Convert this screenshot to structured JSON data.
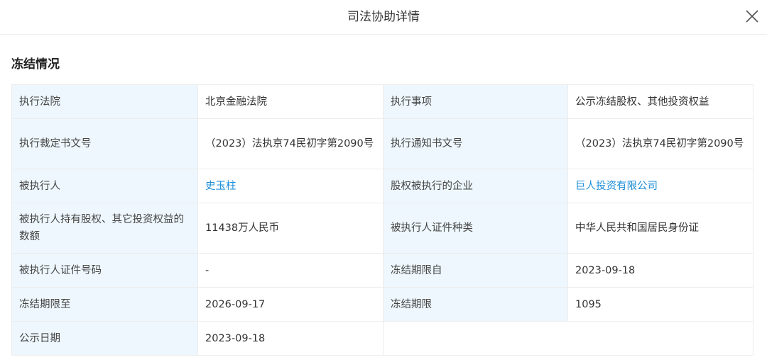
{
  "dialog": {
    "title": "司法协助详情",
    "close_icon": "close-icon"
  },
  "section": {
    "title": "冻结情况"
  },
  "rows": [
    {
      "k1": "执行法院",
      "v1": "北京金融法院",
      "k2": "执行事项",
      "v2": "公示冻结股权、其他投资权益"
    },
    {
      "k1": "执行裁定书文号",
      "v1": "（2023）法执京74民初字第2090号",
      "k2": "执行通知书文号",
      "v2": "（2023）法执京74民初字第2090号"
    },
    {
      "k1": "被执行人",
      "v1": "史玉柱",
      "k2": "股权被执行的企业",
      "v2": "巨人投资有限公司"
    },
    {
      "k1": "被执行人持有股权、其它投资权益的数额",
      "v1": "11438万人民币",
      "k2": "被执行人证件种类",
      "v2": "中华人民共和国居民身份证"
    },
    {
      "k1": "被执行人证件号码",
      "v1": "-",
      "k2": "冻结期限自",
      "v2": "2023-09-18"
    },
    {
      "k1": "冻结期限至",
      "v1": "2026-09-17",
      "k2": "冻结期限",
      "v2": "1095"
    },
    {
      "k1": "公示日期",
      "v1": "2023-09-18"
    }
  ],
  "colors": {
    "label_bg": "#eef7fd",
    "link": "#1e8ed8"
  }
}
